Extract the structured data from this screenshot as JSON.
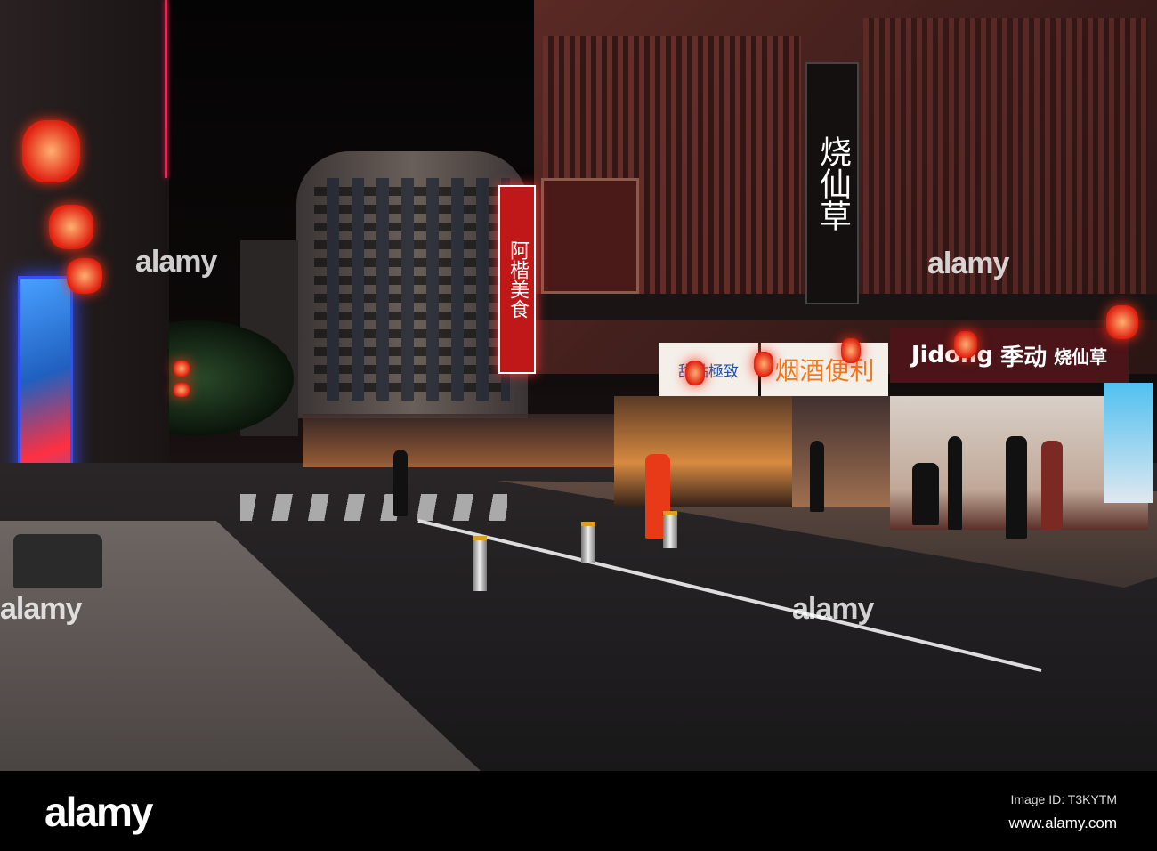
{
  "photo": {
    "signs": {
      "restaurant_vertical": "阿楷美食",
      "grass_jelly_vertical": "烧仙草",
      "dessert_shop": "甜點極致",
      "convenience_store": "烟酒便利",
      "jidong_brand_latin": "Jidong",
      "jidong_brand_cn": "季动",
      "jidong_product": "烧仙草"
    },
    "watermark": "alamy"
  },
  "footer": {
    "logo": "alamy",
    "image_id": "Image ID: T3KYTM",
    "url": "www.alamy.com"
  }
}
